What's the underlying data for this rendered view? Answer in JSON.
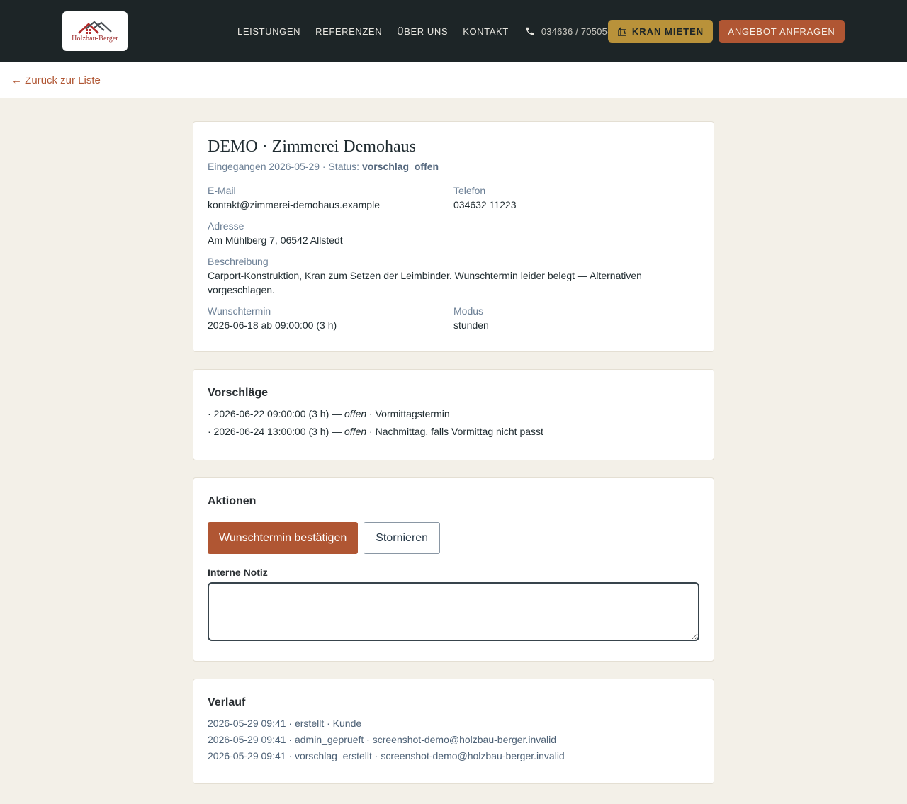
{
  "header": {
    "logo_text": "Holzbau-Berger",
    "nav": [
      "LEISTUNGEN",
      "REFERENZEN",
      "ÜBER UNS",
      "KONTAKT"
    ],
    "phone": "034636 / 705054",
    "cta_kran": "KRAN MIETEN",
    "cta_angebot": "ANGEBOT ANFRAGEN"
  },
  "back_link": "← Zurück zur Liste",
  "detail": {
    "title": "DEMO · Zimmerei Demohaus",
    "received_prefix": "Eingegangen 2026-05-29 · Status: ",
    "status": "vorschlag_offen",
    "email_label": "E-Mail",
    "email": "kontakt@zimmerei-demohaus.example",
    "phone_label": "Telefon",
    "phone": "034632 11223",
    "address_label": "Adresse",
    "address": "Am Mühlberg 7, 06542 Allstedt",
    "description_label": "Beschreibung",
    "description": "Carport-Konstruktion, Kran zum Setzen der Leimbinder. Wunschtermin leider belegt — Alternativen vorgeschlagen.",
    "wish_label": "Wunschtermin",
    "wish": "2026-06-18 ab 09:00:00 (3 h)",
    "mode_label": "Modus",
    "mode": "stunden"
  },
  "proposals": {
    "heading": "Vorschläge",
    "items": [
      {
        "prefix": "· 2026-06-22 09:00:00 (3 h) — ",
        "state": "offen",
        "suffix": " · Vormittagstermin"
      },
      {
        "prefix": "· 2026-06-24 13:00:00 (3 h) — ",
        "state": "offen",
        "suffix": " · Nachmittag, falls Vormittag nicht passt"
      }
    ]
  },
  "actions": {
    "heading": "Aktionen",
    "confirm": "Wunschtermin bestätigen",
    "cancel": "Stornieren",
    "note_label": "Interne Notiz",
    "note_value": ""
  },
  "history": {
    "heading": "Verlauf",
    "items": [
      "2026-05-29 09:41 · erstellt · Kunde",
      "2026-05-29 09:41 · admin_geprueft · screenshot-demo@holzbau-berger.invalid",
      "2026-05-29 09:41 · vorschlag_erstellt · screenshot-demo@holzbau-berger.invalid"
    ]
  },
  "colors": {
    "topbar": "#1d2527",
    "accent": "#b05633",
    "gold": "#b9923a",
    "page_bg": "#f3f0e8"
  }
}
